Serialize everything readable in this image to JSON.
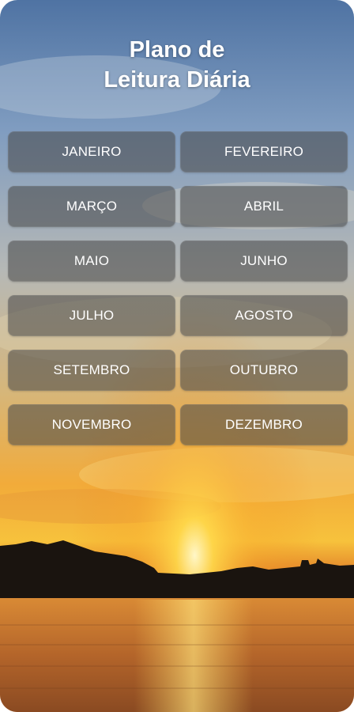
{
  "title": {
    "line1": "Plano de",
    "line2": "Leitura Diária"
  },
  "months": [
    "JANEIRO",
    "FEVEREIRO",
    "MARÇO",
    "ABRIL",
    "MAIO",
    "JUNHO",
    "JULHO",
    "AGOSTO",
    "SETEMBRO",
    "OUTUBRO",
    "NOVEMBRO",
    "DEZEMBRO"
  ],
  "colors": {
    "sky_top": "#4a6fa0",
    "sunset": "#f5a623",
    "button_overlay": "#464646",
    "text": "#ffffff"
  }
}
